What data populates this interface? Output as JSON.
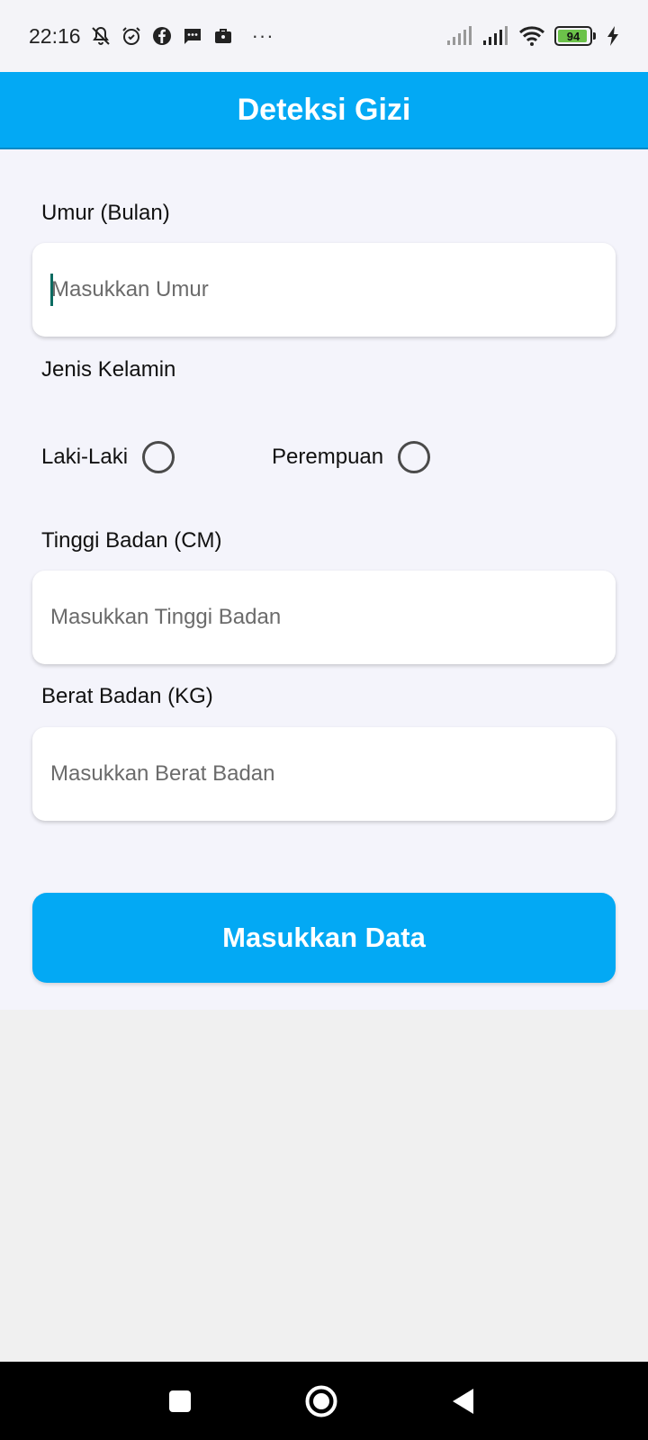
{
  "status_bar": {
    "time": "22:16",
    "icons_left": [
      "bell-off-icon",
      "alarm-icon",
      "facebook-icon",
      "message-icon",
      "briefcase-icon"
    ],
    "more": "···",
    "icons_right": [
      "signal-weak-icon",
      "signal-icon",
      "wifi-icon",
      "battery-icon",
      "charging-icon"
    ],
    "battery_level": "94",
    "battery_fraction": 0.94
  },
  "app_bar": {
    "title": "Deteksi Gizi",
    "color": "#03a9f4"
  },
  "form": {
    "age": {
      "label": "Umur (Bulan)",
      "placeholder": "Masukkan Umur",
      "value": ""
    },
    "gender": {
      "label": "Jenis Kelamin",
      "options": [
        {
          "label": "Laki-Laki",
          "selected": false
        },
        {
          "label": "Perempuan",
          "selected": false
        }
      ]
    },
    "height": {
      "label": "Tinggi Badan (CM)",
      "placeholder": "Masukkan Tinggi Badan",
      "value": ""
    },
    "weight": {
      "label": "Berat Badan (KG)",
      "placeholder": "Masukkan Berat Badan",
      "value": ""
    },
    "submit_label": "Masukkan Data"
  },
  "nav_bar": {
    "buttons": [
      "recents-square-icon",
      "home-circle-icon",
      "back-triangle-icon"
    ]
  }
}
